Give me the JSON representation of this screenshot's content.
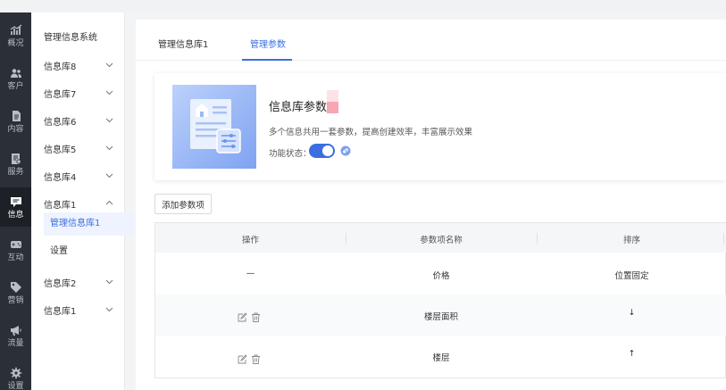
{
  "rail": [
    {
      "icon": "chart-icon",
      "label": "概况"
    },
    {
      "icon": "users-icon",
      "label": "客户"
    },
    {
      "icon": "document-icon",
      "label": "内容"
    },
    {
      "icon": "service-icon",
      "label": "服务"
    },
    {
      "icon": "message-icon",
      "label": "信息",
      "active": true
    },
    {
      "icon": "gamepad-icon",
      "label": "互动"
    },
    {
      "icon": "tag-icon",
      "label": "营销"
    },
    {
      "icon": "megaphone-icon",
      "label": "流量"
    },
    {
      "icon": "gear-icon",
      "label": "设置"
    }
  ],
  "subnav": {
    "title": "管理信息系统",
    "groups": [
      {
        "label": "信息库8",
        "expanded": false
      },
      {
        "label": "信息库7",
        "expanded": false
      },
      {
        "label": "信息库6",
        "expanded": false
      },
      {
        "label": "信息库5",
        "expanded": false
      },
      {
        "label": "信息库4",
        "expanded": false
      },
      {
        "label": "信息库1",
        "expanded": true
      },
      {
        "label": "信息库2",
        "expanded": false
      },
      {
        "label": "信息库1",
        "expanded": false
      }
    ],
    "children": [
      {
        "label": "管理信息库1",
        "active": true
      },
      {
        "label": "设置",
        "active": false
      }
    ]
  },
  "tabs": [
    {
      "label": "管理信息库1",
      "active": false
    },
    {
      "label": "管理参数",
      "active": true
    }
  ],
  "card": {
    "title": "信息库参数",
    "description": "多个信息共用一套参数，提高创建效率，丰富展示效果",
    "status_label": "功能状态：",
    "toggle_on": true
  },
  "add_button": "添加参数项",
  "table": {
    "columns": [
      "操作",
      "参数项名称",
      "排序"
    ],
    "rows": [
      {
        "ops": "—",
        "name": "价格",
        "sort": "位置固定"
      },
      {
        "ops": "edit-delete",
        "name": "楼层面积",
        "sort": "↓"
      },
      {
        "ops": "edit-delete",
        "name": "楼层",
        "sort": "↑"
      }
    ]
  },
  "colors": {
    "accent": "#3b6fe0",
    "rail": "#2b2f36",
    "rail_active": "#1d2026"
  }
}
